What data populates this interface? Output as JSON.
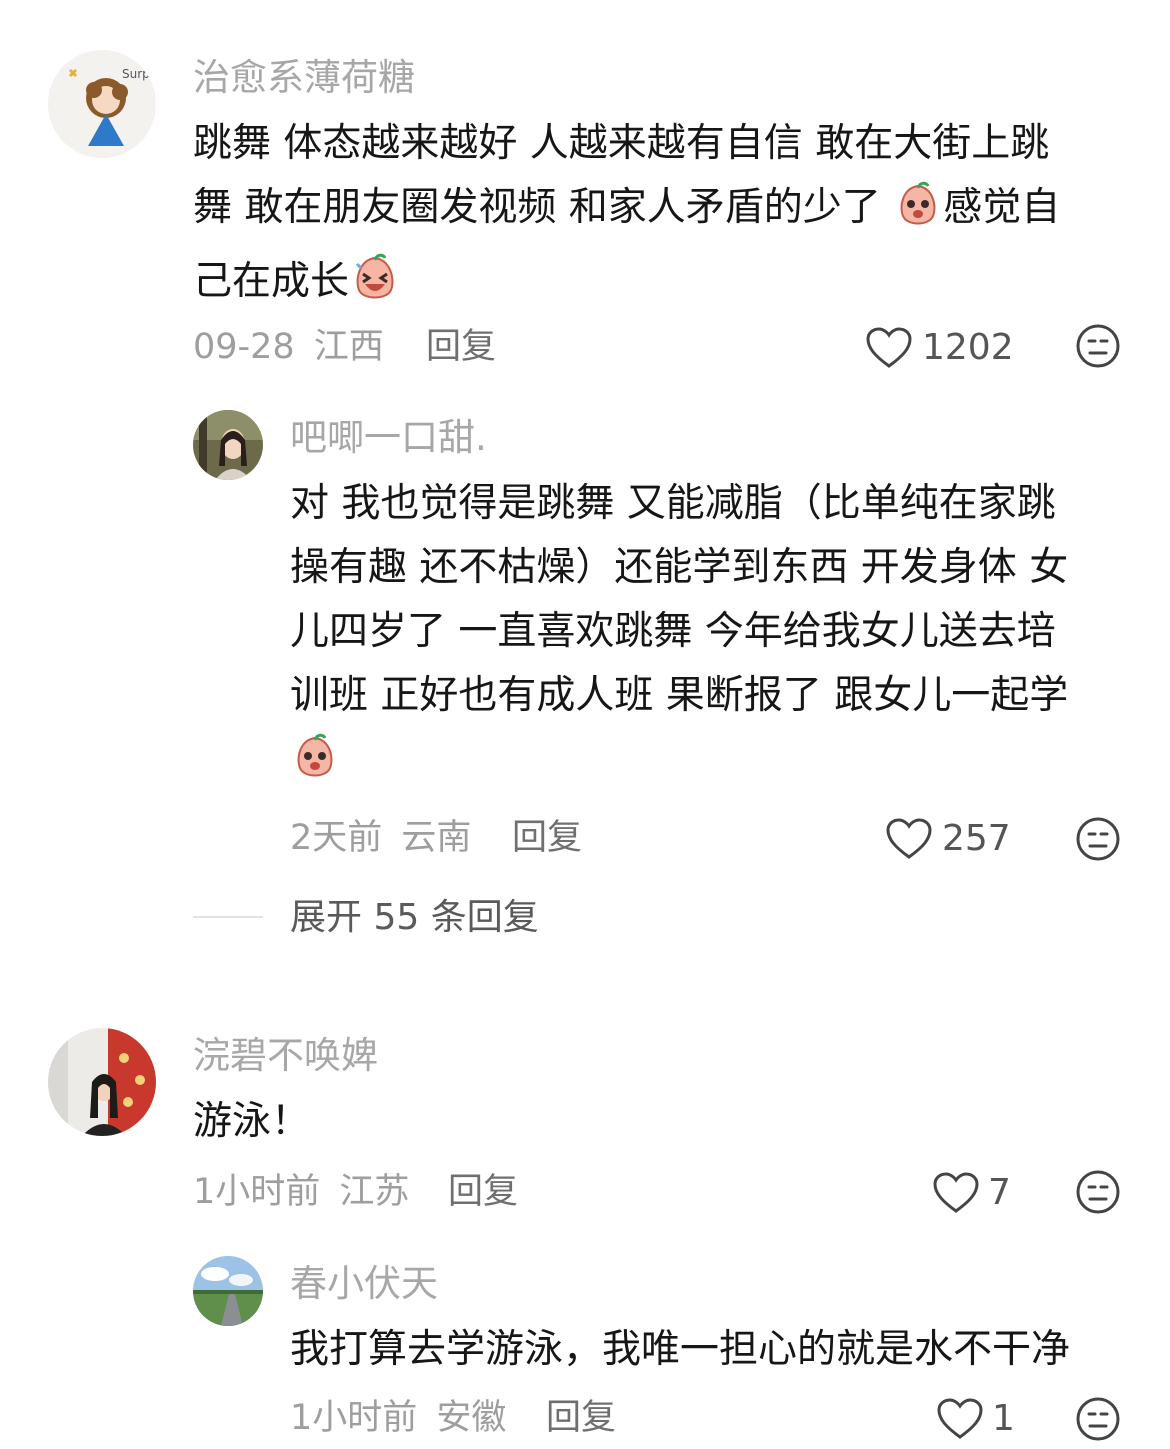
{
  "comments": [
    {
      "username": "治愈系薄荷糖",
      "text_parts": [
        "跳舞 体态越来越好 人越来越有自信 敢在大街上跳",
        "舞 敢在朋友圈发视频 和家人矛盾的少了 ",
        "感觉自",
        "己在成长"
      ],
      "date": "09-28",
      "location": "江西",
      "reply_label": "回复",
      "likes": "1202",
      "reply": {
        "username": "吧唧一口甜.",
        "lines": [
          "对 我也觉得是跳舞 又能减脂（比单纯在家跳",
          "操有趣 还不枯燥）还能学到东西 开发身体 女",
          "儿四岁了 一直喜欢跳舞 今年给我女儿送去培",
          "训班 正好也有成人班 果断报了 跟女儿一起学"
        ],
        "date": "2天前",
        "location": "云南",
        "reply_label": "回复",
        "likes": "257"
      },
      "expand_label": "展开 55 条回复"
    },
    {
      "username": "浣碧不唤婢",
      "text": "游泳！",
      "date": "1小时前",
      "location": "江苏",
      "reply_label": "回复",
      "likes": "7",
      "reply": {
        "username": "春小伏天",
        "text": "我打算去学游泳，我唯一担心的就是水不干净",
        "date": "1小时前",
        "location": "安徽",
        "reply_label": "回复",
        "likes": "1"
      }
    }
  ],
  "icons": {
    "like": "heart-outline-icon",
    "dislike": "meh-face-icon",
    "emoji_1": "peach-shy-emoji",
    "emoji_2": "peach-laugh-emoji"
  }
}
